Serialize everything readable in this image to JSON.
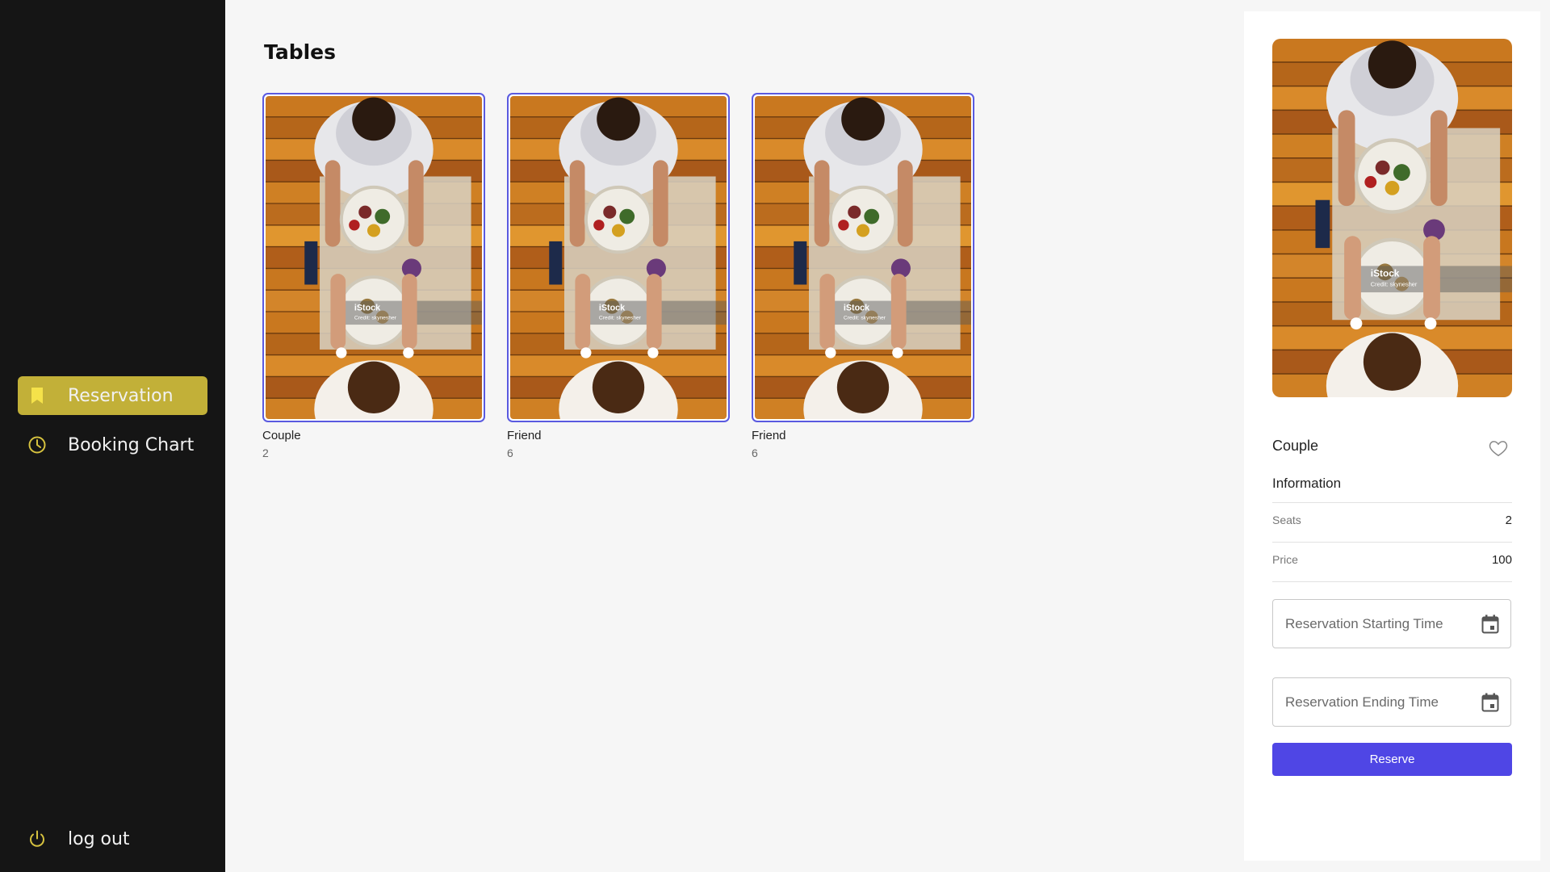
{
  "sidebar": {
    "items": [
      {
        "label": "Reservation",
        "icon": "bookmark-icon",
        "active": true
      },
      {
        "label": "Booking Chart",
        "icon": "clock-icon",
        "active": false
      }
    ],
    "logout_label": "log out"
  },
  "main": {
    "title": "Tables",
    "cards": [
      {
        "name": "Couple",
        "seats": "2"
      },
      {
        "name": "Friend",
        "seats": "6"
      },
      {
        "name": "Friend",
        "seats": "6"
      }
    ],
    "photo_watermark": "iStock",
    "photo_credit": "Credit: skynesher"
  },
  "panel": {
    "name": "Couple",
    "info_title": "Information",
    "seats_label": "Seats",
    "seats_value": "2",
    "price_label": "Price",
    "price_value": "100",
    "start_placeholder": "Reservation Starting Time",
    "end_placeholder": "Reservation Ending Time",
    "reserve_label": "Reserve"
  },
  "colors": {
    "sidebar_bg": "#151515",
    "active_item": "#c2b038",
    "accent_icon": "#d6c23f",
    "card_border": "#5a5ae0",
    "reserve_btn": "#4f46e5"
  }
}
